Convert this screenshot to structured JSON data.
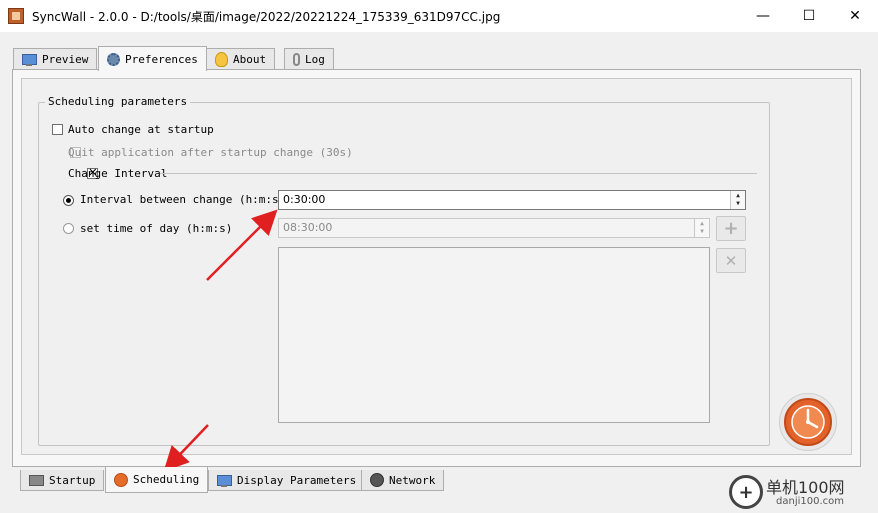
{
  "window": {
    "title": "SyncWall - 2.0.0 - D:/tools/桌面/image/2022/20221224_175339_631D97CC.jpg",
    "minimize": "—",
    "maximize": "☐",
    "close": "✕"
  },
  "top_tabs": [
    {
      "label": "Preview",
      "icon": "monitor-icon"
    },
    {
      "label": "Preferences",
      "icon": "gear-icon",
      "active": true
    },
    {
      "label": "About",
      "icon": "bulb-icon"
    },
    {
      "label": "Log",
      "icon": "paperclip-icon"
    }
  ],
  "scheduling": {
    "group_title": "Scheduling parameters",
    "auto_change_label": "Auto change at startup",
    "auto_change_checked": false,
    "quit_label": "Quit application after  startup change (30s)",
    "quit_enabled": false,
    "change_interval_label": "Change Interval",
    "change_interval_checked": true,
    "interval_label": "Interval between change (h:m:s)",
    "interval_selected": true,
    "interval_value": "0:30:00",
    "timeofday_label": "set time of day (h:m:s)",
    "timeofday_selected": false,
    "timeofday_value": "08:30:00",
    "add_button": "+",
    "remove_button": "✕",
    "spin_up": "▲",
    "spin_down": "▼"
  },
  "bottom_tabs": [
    {
      "label": "Startup",
      "icon": "startup-icon"
    },
    {
      "label": "Scheduling",
      "icon": "clock-icon",
      "active": true
    },
    {
      "label": "Display Parameters",
      "icon": "monitor-icon"
    },
    {
      "label": "Network",
      "icon": "globe-icon"
    }
  ],
  "watermark": {
    "logo": "+",
    "title": "单机100网",
    "url": "danji100.com"
  },
  "colors": {
    "annotation_arrow": "#e02020",
    "clock_orange": "#e2622a"
  }
}
